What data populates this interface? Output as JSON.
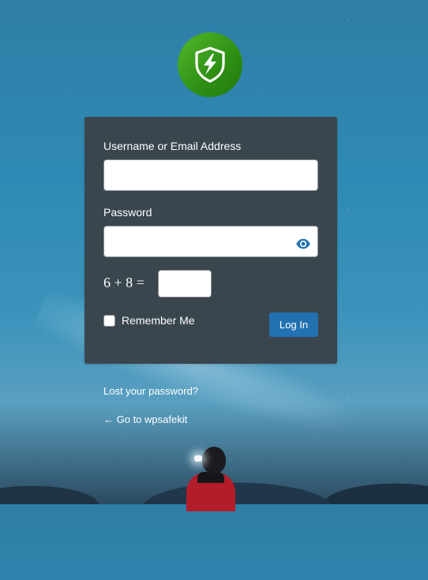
{
  "logo": {
    "icon": "shield-lightning-icon"
  },
  "form": {
    "username_label": "Username or Email Address",
    "username_value": "",
    "password_label": "Password",
    "password_value": "",
    "show_password_icon": "eye-icon",
    "captcha_question": "6 + 8 =",
    "captcha_value": "",
    "remember_label": "Remember Me",
    "remember_checked": false,
    "login_label": "Log In"
  },
  "links": {
    "lost_password": "Lost your password?",
    "back_to_site": "← Go to wpsafekit"
  },
  "colors": {
    "card_bg": "#3a464e",
    "button_bg": "#2271b1",
    "logo_green": "#3aa21e"
  }
}
